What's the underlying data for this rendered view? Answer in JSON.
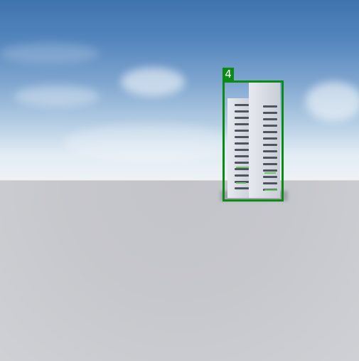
{
  "scene": {
    "sky_top_color": "#3f73ad",
    "sky_horizon_color": "#eef2f7",
    "ground_color": "#c7c8ce"
  },
  "detection": {
    "label": "4",
    "box_color": "#0b8a16",
    "object": "building"
  }
}
